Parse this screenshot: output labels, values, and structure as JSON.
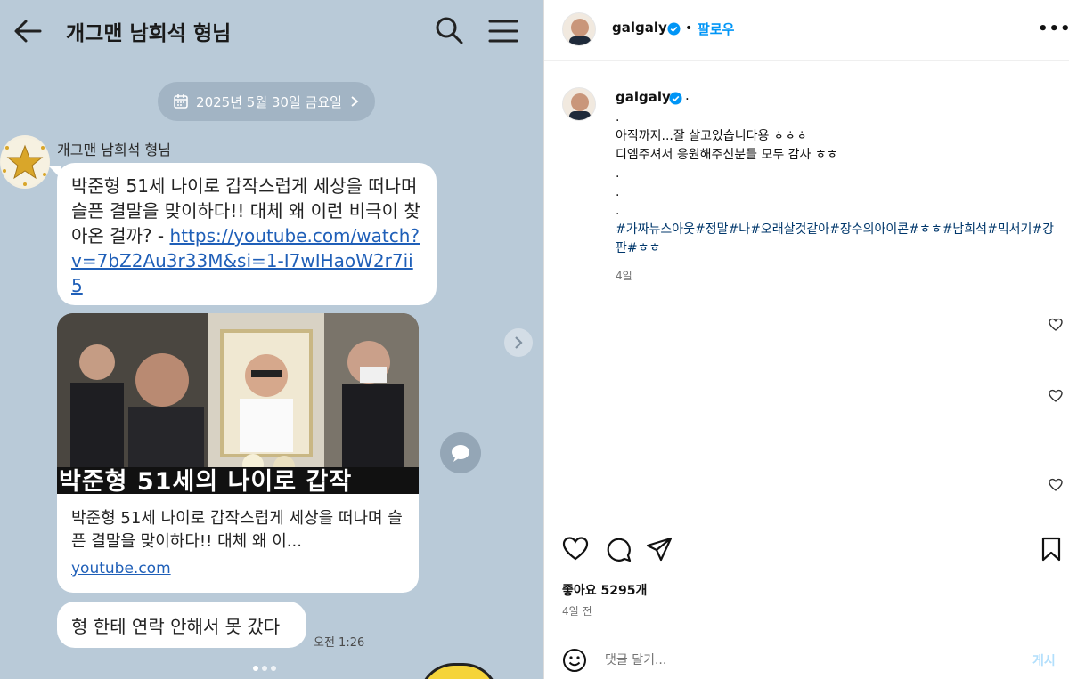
{
  "chat": {
    "title": "개그맨 남희석 형님",
    "date_label": "2025년 5월 30일 금요일",
    "sender_name": "개그맨 남희석 형님",
    "message_1_text": "박준형 51세 나이로 갑작스럽게 세상을 떠나며 슬픈 결말을 맞이하다!! 대체 왜 이런 비극이 찾아온 걸까? -",
    "message_1_link": "https://youtube.com/watch?v=7bZ2Au3r33M&si=1-I7wIHaoW2r7ii5",
    "card": {
      "thumbnail_caption": "박준형 51세의 나이로 갑작",
      "title": "박준형 51세 나이로 갑작스럽게 세상을 떠나며 슬픈 결말을 맞이하다!! 대체 왜 이...",
      "domain": "youtube.com"
    },
    "message_2_text": "형 한테 연락 안해서 못 갔다",
    "message_2_time": "오전 1:26",
    "icons": [
      "back-arrow-icon",
      "search-icon",
      "menu-icon",
      "calendar-icon",
      "chevron-right-icon",
      "share-icon",
      "comment-icon"
    ]
  },
  "instagram": {
    "username": "galgaly",
    "follow_dot": "•",
    "follow_label": "팔로우",
    "more_label": "•••",
    "caption_username": "galgaly",
    "caption_first": ".",
    "caption_lines": [
      ".",
      "아직까지...잘 살고있습니다용 ㅎㅎㅎ",
      "디엠주셔서 응원해주신분들 모두 감사 ㅎㅎ",
      ".",
      ".",
      "."
    ],
    "hashtags": "#가짜뉴스아웃#정말#나#오래살것같아#장수의아이콘#ㅎㅎ#남희석#믹서기#강판#ㅎㅎ",
    "caption_age": "4일",
    "likes": "좋아요 5295개",
    "post_age": "4일 전",
    "comment_placeholder": "댓글 달기...",
    "post_label": "게시",
    "colors": {
      "link_blue": "#0095f6",
      "hashtag": "#00376b",
      "verified": "#0095f6"
    }
  }
}
